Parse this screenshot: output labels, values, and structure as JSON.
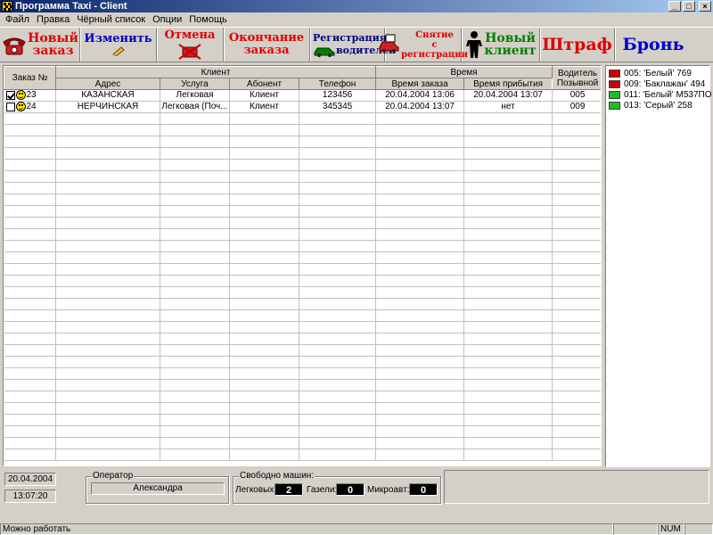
{
  "window": {
    "title": "Программа Taxi - Client"
  },
  "menu": [
    "Файл",
    "Правка",
    "Чёрный список",
    "Опции",
    "Помощь"
  ],
  "toolbar": {
    "new_order": [
      "Новый",
      "заказ"
    ],
    "edit": "Изменить",
    "cancel": "Отмена",
    "finish": [
      "Окончание",
      "заказа"
    ],
    "driver_reg": [
      "Регистрация",
      "водителей"
    ],
    "dereg": [
      "Снятие",
      "с",
      "регистрации"
    ],
    "new_client": [
      "Новый",
      "клиент"
    ],
    "fine": "Штраф",
    "booking": "Бронь"
  },
  "table": {
    "group_headers": {
      "order_no": "Заказ №",
      "client": "Клиент",
      "time": "Время",
      "driver": "Водитель Позывной"
    },
    "columns": {
      "address": "Адрес",
      "service": "Услуга",
      "subscriber": "Абонент",
      "phone": "Телефон",
      "order_time": "Время заказа",
      "arrival_time": "Время прибытия"
    },
    "rows": [
      {
        "checked": true,
        "no": "23",
        "address": "КАЗАНСКАЯ",
        "service": "Легковая",
        "subscriber": "Клиент",
        "phone": "123456",
        "order_time": "20.04.2004   13:06",
        "arrival_time": "20.04.2004   13:07",
        "driver": "005"
      },
      {
        "checked": false,
        "no": "24",
        "address": "НЕРЧИНСКАЯ",
        "service": "Легковая (Поч...",
        "subscriber": "Клиент",
        "phone": "345345",
        "order_time": "20.04.2004   13:07",
        "arrival_time": "нет",
        "driver": "009"
      }
    ]
  },
  "drivers": [
    {
      "label": "005: 'Белый' 769",
      "color": "#cc0000"
    },
    {
      "label": "009: 'Баклажан'  494",
      "color": "#cc0000"
    },
    {
      "label": "011: 'Белый' М537ПО",
      "color": "#22bb22"
    },
    {
      "label": "013: 'Серый' 258",
      "color": "#22bb22"
    }
  ],
  "bottom": {
    "date": "20.04.2004",
    "time": "13:07:20",
    "operator_label": "Оператор",
    "operator_name": "Александра",
    "free_label": "Свободно машин:",
    "cars_label": "Легковых:",
    "cars_value": "2",
    "gazelles_label": "Газели:",
    "gazelles_value": "0",
    "minibus_label": "Микроавт:",
    "minibus_value": "0"
  },
  "status": {
    "text": "Можно работать",
    "num": "NUM"
  }
}
